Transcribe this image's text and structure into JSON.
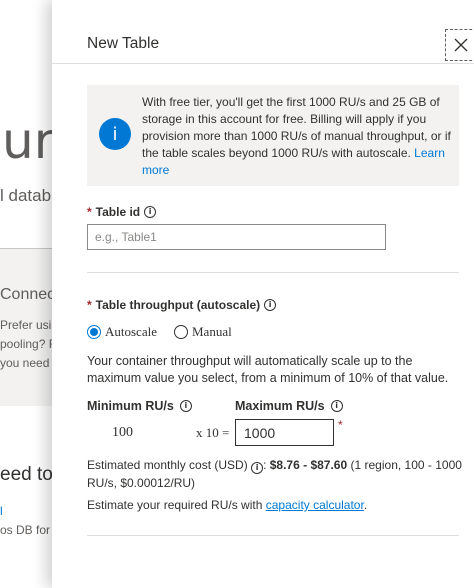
{
  "background": {
    "title_fragment": "ure",
    "subtitle_fragment": "l datab",
    "connect_fragment": "Connec",
    "lines": [
      "Prefer usir",
      "pooling? Fi",
      "you need t"
    ],
    "heading_fragment": "eed to",
    "link_fragment": "l",
    "db_fragment": "os DB for"
  },
  "panel": {
    "title": "New Table",
    "close_icon": "close-icon"
  },
  "info": {
    "icon_glyph": "i",
    "text": "With free tier, you'll get the first 1000 RU/s and 25 GB of storage in this account for free. Billing will apply if you provision more than 1000 RU/s of manual throughput, or if the table scales beyond 1000 RU/s with autoscale.",
    "learn_more": "Learn more"
  },
  "table_id": {
    "required_mark": "*",
    "label": "Table id",
    "info_glyph": "i",
    "placeholder": "e.g., Table1",
    "value": ""
  },
  "throughput": {
    "required_mark": "*",
    "label": "Table throughput (autoscale)",
    "info_glyph": "i",
    "options": [
      "Autoscale",
      "Manual"
    ],
    "selected": "Autoscale",
    "description": "Your container throughput will automatically scale up to the maximum value you select, from a minimum of 10% of that value.",
    "min_label": "Minimum RU/s",
    "max_label": "Maximum RU/s",
    "min_value": "100",
    "multiplier": "x 10 =",
    "max_value": "1000",
    "max_required_mark": "*",
    "cost_prefix": "Estimated monthly cost (USD)",
    "cost_colon": ":",
    "cost_range": "$8.76 - $87.60",
    "cost_details": "(1 region, 100 - 1000 RU/s, $0.00012/RU)",
    "estimate_prefix": "Estimate your required RU/s with",
    "estimate_link": "capacity calculator",
    "estimate_suffix": "."
  },
  "colors": {
    "accent": "#0078d4",
    "required": "#a4262c",
    "info_bg": "#f3f2f1"
  }
}
